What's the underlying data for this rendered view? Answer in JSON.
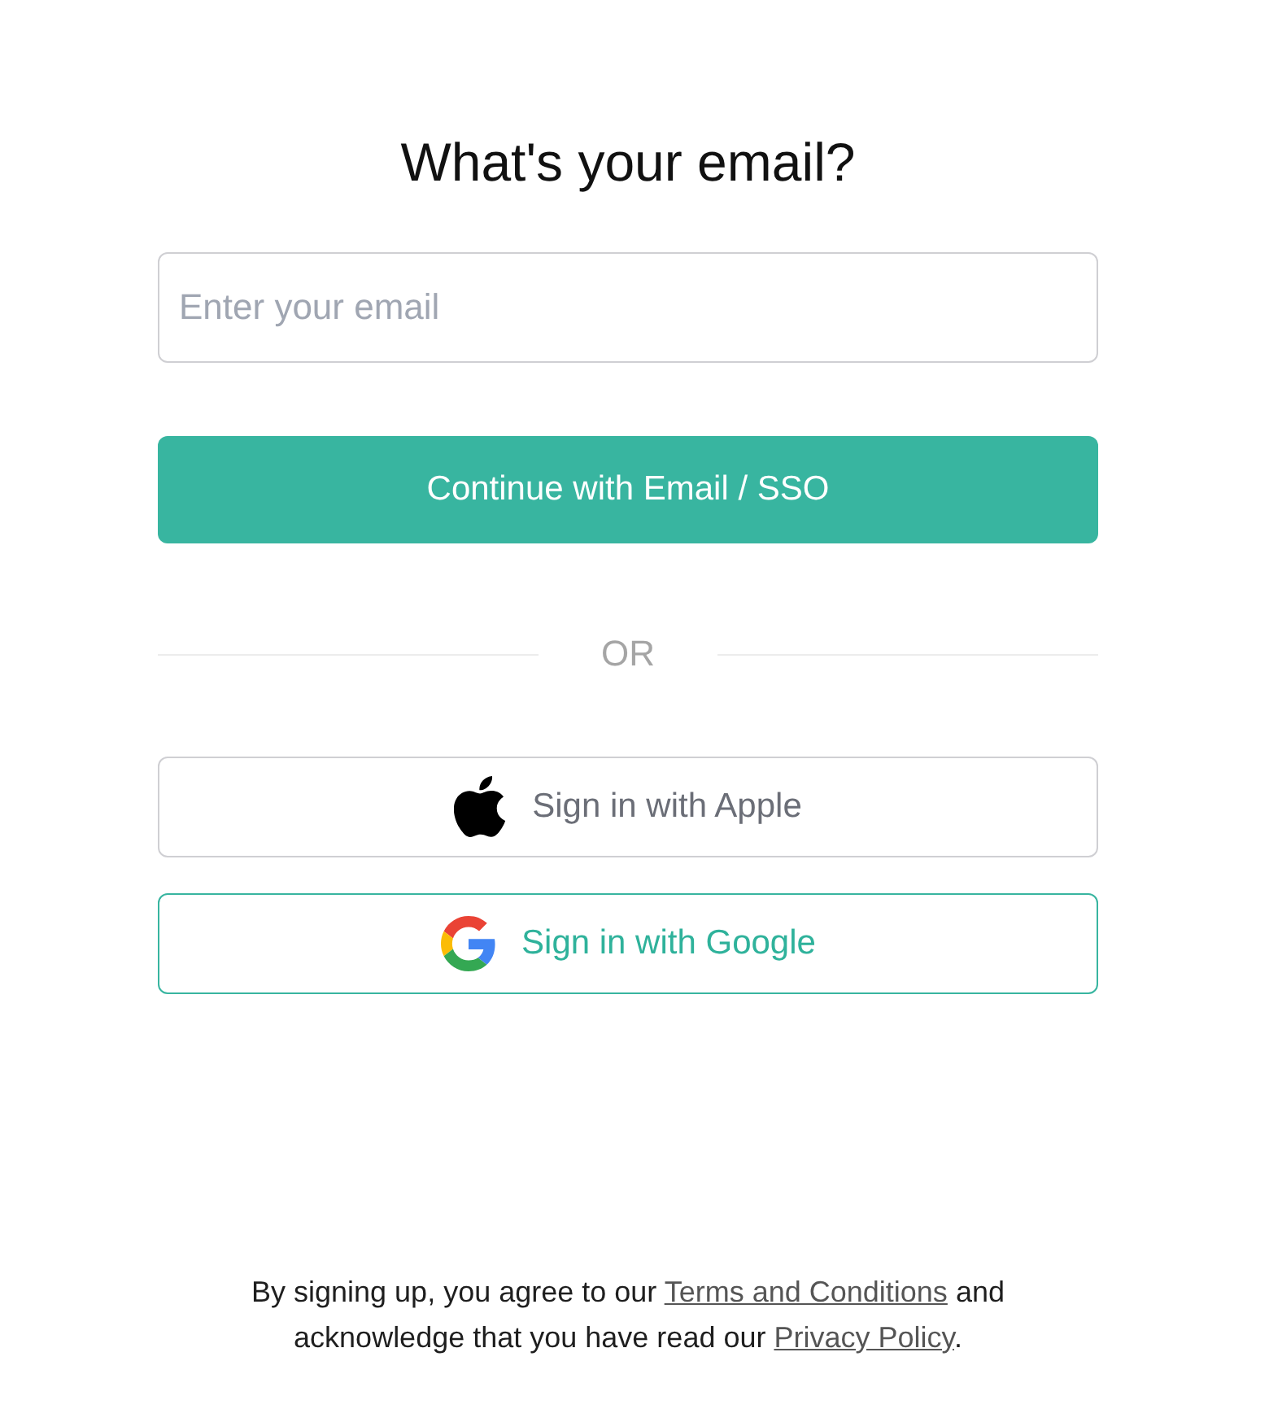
{
  "heading": "What's your email?",
  "email_field": {
    "placeholder": "Enter your email"
  },
  "continue_button": {
    "label": "Continue with Email / SSO"
  },
  "divider": {
    "label": "OR"
  },
  "sign_in_buttons": [
    {
      "kind": "apple",
      "label": "Sign in with Apple"
    },
    {
      "kind": "google",
      "label": "Sign in with Google"
    }
  ],
  "footer": {
    "segments": [
      {
        "kind": "text",
        "text": "By signing up, you agree to our "
      },
      {
        "kind": "link",
        "text": "Terms and Conditions"
      },
      {
        "kind": "text",
        "text": " and acknowledge that you have read our "
      },
      {
        "kind": "link",
        "text": "Privacy Policy"
      },
      {
        "kind": "text",
        "text": "."
      }
    ]
  }
}
